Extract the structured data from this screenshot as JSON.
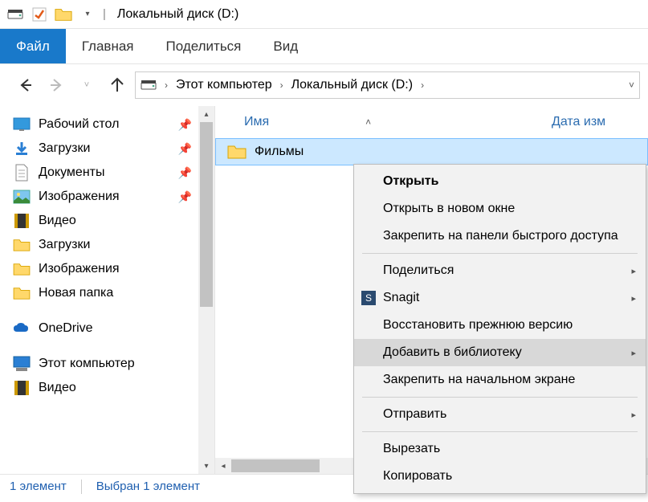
{
  "window": {
    "title": "Локальный диск (D:)"
  },
  "ribbon": {
    "file": "Файл",
    "tabs": [
      "Главная",
      "Поделиться",
      "Вид"
    ]
  },
  "breadcrumb": {
    "items": [
      "Этот компьютер",
      "Локальный диск (D:)"
    ]
  },
  "tree": {
    "quick": [
      {
        "label": "Рабочий стол",
        "icon": "desktop",
        "pinned": true
      },
      {
        "label": "Загрузки",
        "icon": "download",
        "pinned": true
      },
      {
        "label": "Документы",
        "icon": "document",
        "pinned": true
      },
      {
        "label": "Изображения",
        "icon": "pictures",
        "pinned": true
      },
      {
        "label": "Видео",
        "icon": "video",
        "pinned": false
      },
      {
        "label": "Загрузки",
        "icon": "folder",
        "pinned": false
      },
      {
        "label": "Изображения",
        "icon": "folder",
        "pinned": false
      },
      {
        "label": "Новая папка",
        "icon": "folder",
        "pinned": false
      }
    ],
    "onedrive": {
      "label": "OneDrive"
    },
    "thispc": {
      "label": "Этот компьютер"
    },
    "thispc_items": [
      {
        "label": "Видео",
        "icon": "video"
      }
    ]
  },
  "columns": {
    "name": "Имя",
    "date": "Дата изм"
  },
  "files": [
    {
      "name": "Фильмы",
      "date_partial": ""
    }
  ],
  "status": {
    "count": "1 элемент",
    "selected": "Выбран 1 элемент"
  },
  "ctx": {
    "open": "Открыть",
    "open_new": "Открыть в новом окне",
    "pin_qa": "Закрепить на панели быстрого доступа",
    "share": "Поделиться",
    "snagit": "Snagit",
    "restore": "Восстановить прежнюю версию",
    "add_lib": "Добавить в библиотеку",
    "pin_start": "Закрепить на начальном экране",
    "send_to": "Отправить",
    "cut": "Вырезать",
    "copy": "Копировать"
  }
}
